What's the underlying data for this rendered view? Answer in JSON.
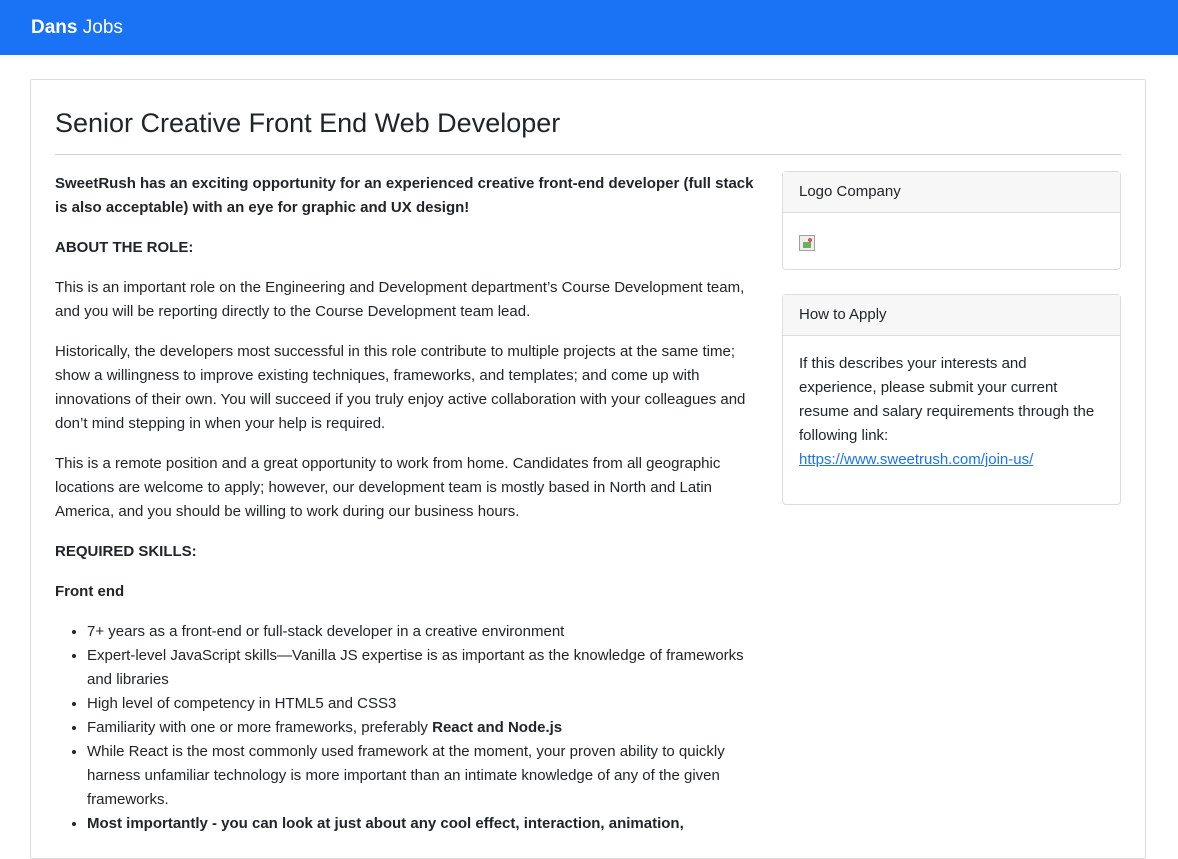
{
  "navbar": {
    "brand_bold": "Dans",
    "brand_rest": "Jobs"
  },
  "job": {
    "title": "Senior Creative Front End Web Developer",
    "intro": "SweetRush has an exciting opportunity for an experienced creative front-end developer (full stack is also acceptable) with an eye for graphic and UX design!",
    "about_heading": "ABOUT THE ROLE:",
    "paragraphs": [
      "This is an important role on the Engineering and Development department’s Course Development team, and you will be reporting directly to the Course Development team lead.",
      "Historically, the developers most successful in this role contribute to multiple projects at the same time; show a willingness to improve existing techniques, frameworks, and templates; and come up with innovations of their own. You will succeed if you truly enjoy active collaboration with your colleagues and don’t mind stepping in when your help is required.",
      "This is a remote position and a great opportunity to work from home. Candidates from all geographic locations are welcome to apply; however, our development team is mostly based in North and Latin America, and you should be willing to work during our business hours."
    ],
    "skills_heading": "REQUIRED SKILLS:",
    "frontend_heading": "Front end",
    "skills": [
      "7+ years as a front-end or full-stack developer in a creative environment",
      "Expert-level JavaScript skills—Vanilla JS expertise is as important as the knowledge of frameworks and libraries",
      "High level of competency in HTML5 and CSS3",
      "Familiarity with one or more frameworks, preferably ",
      "While React is the most commonly used framework at the moment, your proven ability to quickly harness unfamiliar technology is more important than an intimate knowledge of any of the given frameworks.",
      "Most importantly - you can look at just about any cool effect, interaction, animation,"
    ],
    "skill_4_bold": "React and Node.js"
  },
  "logo_card": {
    "heading": "Logo Company"
  },
  "apply_card": {
    "heading": "How to Apply",
    "text": "If this describes your interests and experience, please submit your current resume and salary requirements through the following link:",
    "link": "https://www.sweetrush.com/join-us/"
  },
  "colors": {
    "navbar": "#1a73f5",
    "link": "#1a73f5",
    "card_header": "#f7f7f7"
  }
}
